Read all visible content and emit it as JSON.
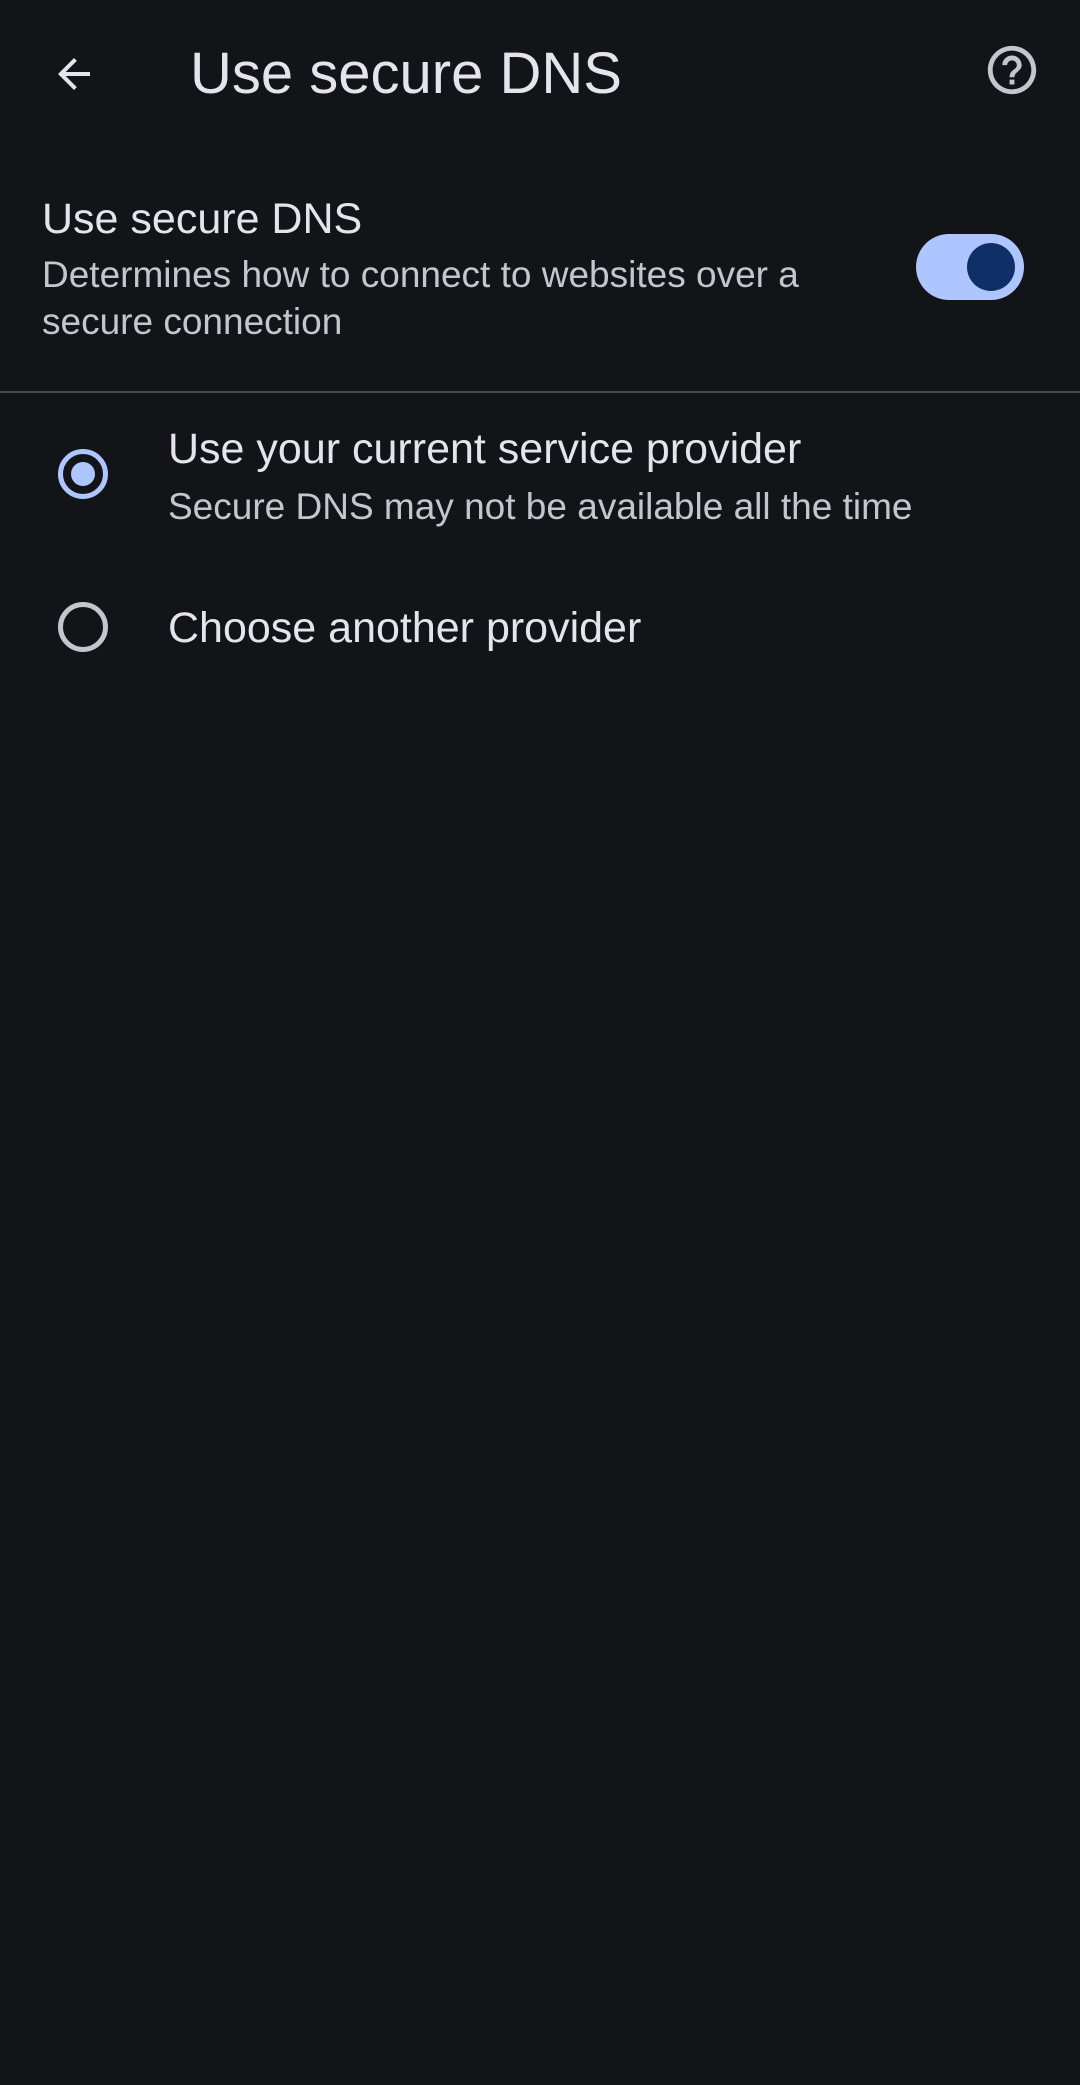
{
  "app_bar": {
    "title": "Use secure DNS",
    "back_icon": "arrow-back-icon",
    "help_icon": "help-circle-icon"
  },
  "secure_dns_toggle": {
    "title": "Use secure DNS",
    "description": "Determines how to connect to websites over a secure connection",
    "enabled": true
  },
  "options": [
    {
      "label": "Use your current service provider",
      "sublabel": "Secure DNS may not be available all the time",
      "selected": true
    },
    {
      "label": "Choose another provider",
      "selected": false
    }
  ],
  "colors": {
    "background": "#131418",
    "accent": "#aec6ff",
    "switch_thumb": "#0f2f66",
    "primary_text": "#e4e4ea",
    "secondary_text": "#c4c6cf",
    "divider": "#4a4c52"
  }
}
